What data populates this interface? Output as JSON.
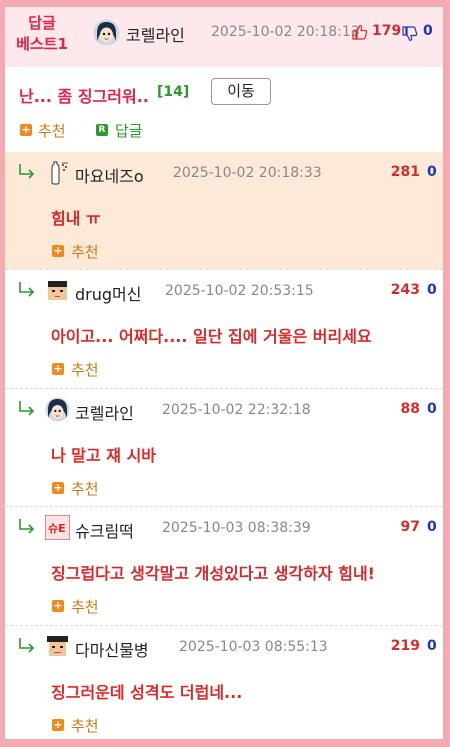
{
  "header": {
    "best_label": [
      "답글",
      "베스트1"
    ],
    "author": "코렐라인",
    "date": "2025-10-02 20:18:13",
    "up_count": "179",
    "down_count": "0"
  },
  "post": {
    "title": "난... 좀 징그러워..",
    "reply_count": "[14]",
    "move_button": "이동",
    "recommend_label": "추천",
    "reply_label": "답글"
  },
  "colors": {
    "brand_pink": "#e0244a",
    "frame_pink": "#f5aab2",
    "header_bg": "#fde9ec",
    "highlight_bg": "#fde9d8",
    "up_red": "#d52c2c",
    "down_blue": "#2233bb",
    "recommend_orange": "#f08a1c",
    "reply_green": "#2a9a2a"
  },
  "replies": [
    {
      "nick": "마요네즈o",
      "date": "2025-10-02 20:18:33",
      "up": "281",
      "down": "0",
      "text": "힘내 ㅠ",
      "recommend": "추천",
      "avatar": "mayonnaise-bottle-icon",
      "highlight": true
    },
    {
      "nick": "drug머신",
      "date": "2025-10-02 20:53:15",
      "up": "243",
      "down": "0",
      "text": "아이고... 어쩌다.... 일단 집에 거울은 버리세요",
      "recommend": "추천",
      "avatar": "pixel-face-icon",
      "highlight": false
    },
    {
      "nick": "코렐라인",
      "date": "2025-10-02 22:32:18",
      "up": "88",
      "down": "0",
      "text": "나 말고 쟤 시바",
      "recommend": "추천",
      "avatar": "coraline-icon",
      "highlight": false
    },
    {
      "nick": "슈크림떡",
      "date": "2025-10-03 08:38:39",
      "up": "97",
      "down": "0",
      "text": "징그럽다고 생각말고 개성있다고 생각하자 힘내!",
      "recommend": "추천",
      "avatar": "pink-badge-icon",
      "highlight": false
    },
    {
      "nick": "다마신물병",
      "date": "2025-10-03 08:55:13",
      "up": "219",
      "down": "0",
      "text": "징그러운데 성격도 더럽네...",
      "recommend": "추천",
      "avatar": "pixel-grad-icon",
      "highlight": false
    }
  ]
}
